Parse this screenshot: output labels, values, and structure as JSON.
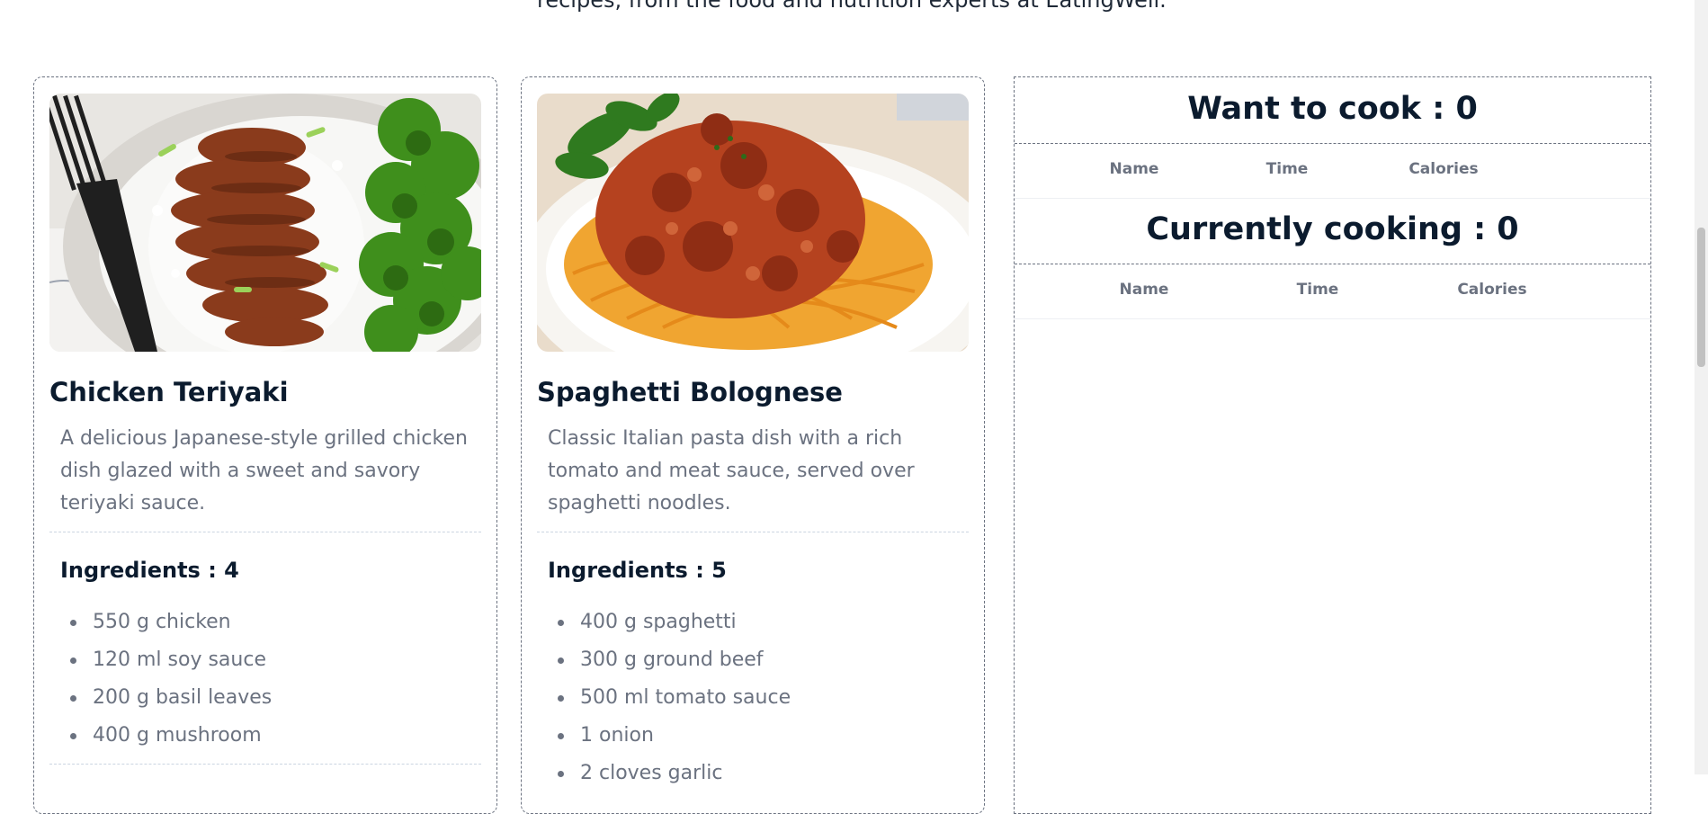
{
  "intro_text": "recipes, from the food and nutrition experts at EatingWell.",
  "recipes": [
    {
      "name": "Chicken Teriyaki",
      "description": "A delicious Japanese-style grilled chicken dish glazed with a sweet and savory teriyaki sauce.",
      "ingredients_heading": "Ingredients : 4",
      "ingredients": [
        "550 g chicken",
        "120 ml soy sauce",
        "200 g basil leaves",
        "400 g mushroom"
      ]
    },
    {
      "name": "Spaghetti Bolognese",
      "description": "Classic Italian pasta dish with a rich tomato and meat sauce, served over spaghetti noodles.",
      "ingredients_heading": "Ingredients : 5",
      "ingredients": [
        "400 g spaghetti",
        "300 g ground beef",
        "500 ml tomato sauce",
        "1 onion",
        "2 cloves garlic"
      ]
    }
  ],
  "sidebar": {
    "want_to_cook": {
      "heading": "Want to cook : 0",
      "columns": [
        "Name",
        "Time",
        "Calories"
      ]
    },
    "currently_cooking": {
      "heading": "Currently cooking : 0",
      "columns": [
        "Name",
        "Time",
        "Calories"
      ]
    }
  },
  "colors": {
    "heading": "#0b1b2e",
    "muted_text": "#6b7280",
    "border": "#6b7280"
  }
}
